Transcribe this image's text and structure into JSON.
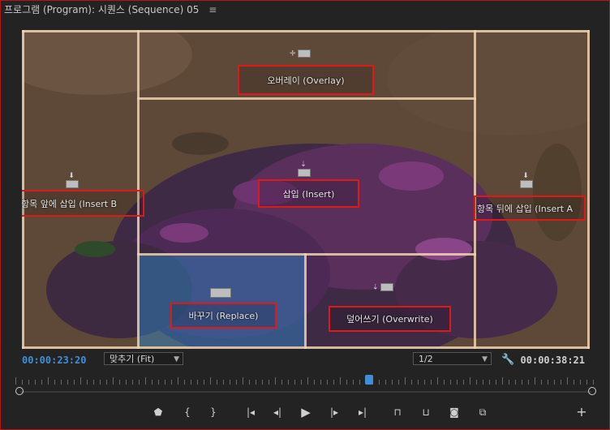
{
  "panel": {
    "title": "프로그램 (Program): 시퀀스 (Sequence) 05",
    "menu_icon": "hamburger-menu-icon"
  },
  "overlay_zones": {
    "overlay": "오버레이 (Overlay)",
    "insert": "삽입 (Insert)",
    "insert_before": "항목 앞에 삽입 (Insert B",
    "insert_after": "항목 뒤에 삽입 (Insert A",
    "replace": "바꾸기 (Replace)",
    "overwrite": "덮어쓰기 (Overwrite)"
  },
  "colors": {
    "highlight_border": "#e01818",
    "timecode_current": "#3f8fd8",
    "replace_fill": "#2e8cd2"
  },
  "controls": {
    "current_timecode": "00:00:23:20",
    "zoom_select": "맞추기 (Fit)",
    "resolution_select": "1/2",
    "duration_timecode": "00:00:38:21"
  },
  "transport_icons": [
    "add-marker-icon",
    "mark-in-icon",
    "mark-out-icon",
    "go-to-in-icon",
    "step-back-icon",
    "play-icon",
    "step-forward-icon",
    "go-to-out-icon",
    "lift-icon",
    "extract-icon",
    "export-frame-icon",
    "comparison-view-icon",
    "button-editor-icon"
  ]
}
